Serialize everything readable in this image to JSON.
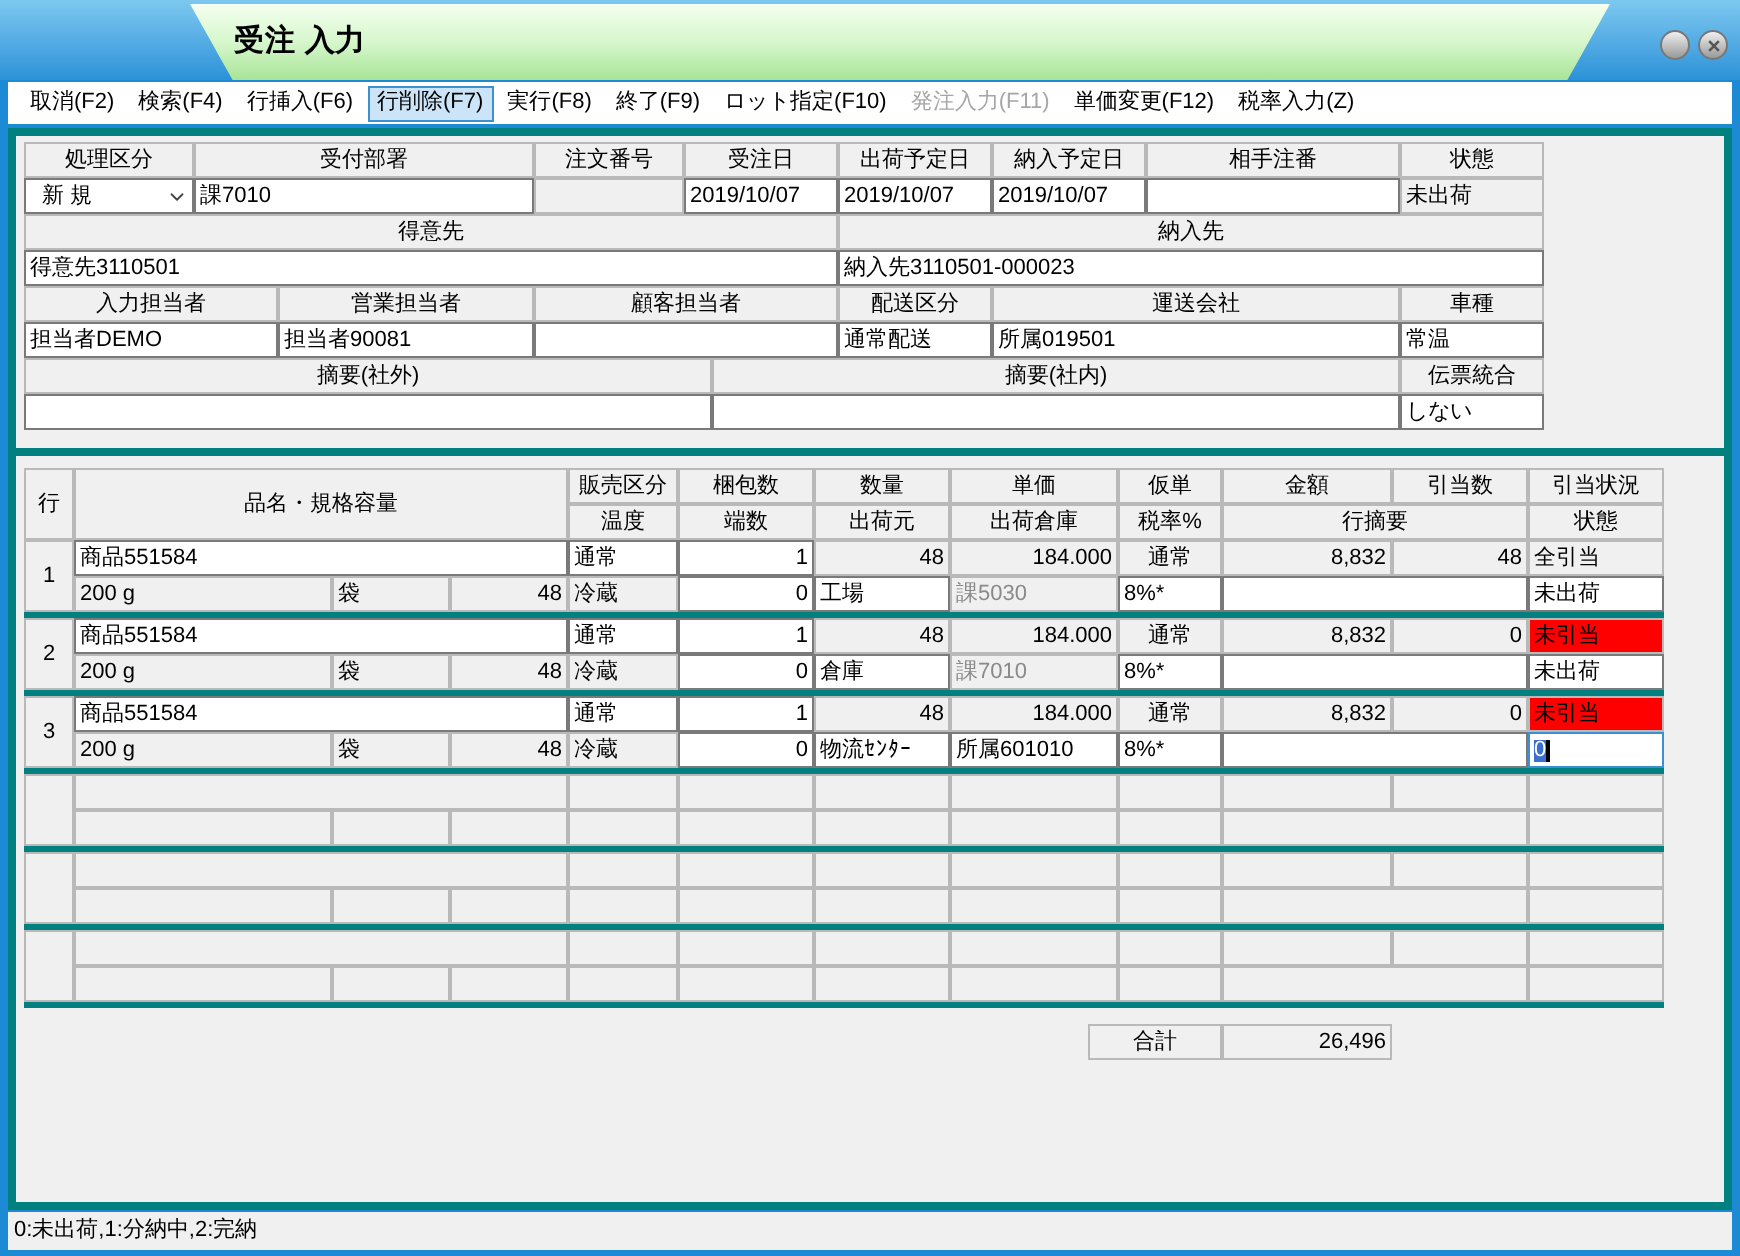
{
  "window": {
    "title": "受注 入力"
  },
  "toolbar": [
    {
      "label": "取消(F2)",
      "selected": false,
      "disabled": false
    },
    {
      "label": "検索(F4)",
      "selected": false,
      "disabled": false
    },
    {
      "label": "行挿入(F6)",
      "selected": false,
      "disabled": false
    },
    {
      "label": "行削除(F7)",
      "selected": true,
      "disabled": false
    },
    {
      "label": "実行(F8)",
      "selected": false,
      "disabled": false
    },
    {
      "label": "終了(F9)",
      "selected": false,
      "disabled": false
    },
    {
      "label": "ロット指定(F10)",
      "selected": false,
      "disabled": false
    },
    {
      "label": "発注入力(F11)",
      "selected": false,
      "disabled": true
    },
    {
      "label": "単価変更(F12)",
      "selected": false,
      "disabled": false
    },
    {
      "label": "税率入力(Z)",
      "selected": false,
      "disabled": false
    }
  ],
  "header": {
    "order": [
      {
        "label": "処理区分",
        "kind": "select",
        "value": "新 規"
      },
      {
        "label": "受付部署",
        "kind": "input",
        "value": "課7010"
      },
      {
        "label": "注文番号",
        "kind": "readonly"
      },
      {
        "label": "受注日",
        "kind": "input",
        "value": "2019/10/07"
      },
      {
        "label": "出荷予定日",
        "kind": "input",
        "value": "2019/10/07"
      },
      {
        "label": "納入予定日",
        "kind": "input",
        "value": "2019/10/07"
      },
      {
        "label": "相手注番",
        "kind": "input"
      },
      {
        "label": "状態",
        "kind": "readonly",
        "value": "未出荷"
      }
    ],
    "parties": [
      {
        "label": "得意先",
        "kind": "input",
        "value": "得意先3110501"
      },
      {
        "label": "納入先",
        "kind": "input",
        "value": "納入先3110501-000023"
      }
    ],
    "staff": [
      {
        "label": "入力担当者",
        "kind": "input",
        "value": "担当者DEMO"
      },
      {
        "label": "営業担当者",
        "kind": "input",
        "value": "担当者90081"
      },
      {
        "label": "顧客担当者",
        "kind": "input"
      },
      {
        "label": "配送区分",
        "kind": "input",
        "value": "通常配送"
      },
      {
        "label": "運送会社",
        "kind": "input",
        "value": "所属019501"
      },
      {
        "label": "車種",
        "kind": "input",
        "value": "常温"
      }
    ],
    "notes": [
      {
        "label": "摘要(社外)",
        "kind": "input"
      },
      {
        "label": "摘要(社内)",
        "kind": "input"
      },
      {
        "label": "伝票統合",
        "kind": "input",
        "value": "しない"
      }
    ]
  },
  "detail": {
    "header_top": [
      "行",
      "品名・規格容量",
      "販売区分",
      "梱包数",
      "数量",
      "単価",
      "仮単",
      "金額",
      "引当数",
      "引当状況"
    ],
    "header_bottom": [
      "温度",
      "端数",
      "出荷元",
      "出荷倉庫",
      "税率%",
      "行摘要",
      "状態"
    ],
    "rows": [
      {
        "line": "1",
        "product": "商品551584",
        "spec": "200 g",
        "unit": "袋",
        "per_pack": "48",
        "sales_type": "通常",
        "temperature": "冷蔵",
        "packages": "1",
        "fraction": "0",
        "quantity": "48",
        "origin": "工場",
        "unit_price": "184.000",
        "warehouse": "課5030",
        "warehouse_editable": false,
        "tentative": "通常",
        "tax": "8%*",
        "amount": "8,832",
        "allocated": "48",
        "allocation_status": "全引当",
        "allocation_alert": false,
        "shipping_status": "未出荷",
        "focused": false
      },
      {
        "line": "2",
        "product": "商品551584",
        "spec": "200 g",
        "unit": "袋",
        "per_pack": "48",
        "sales_type": "通常",
        "temperature": "冷蔵",
        "packages": "1",
        "fraction": "0",
        "quantity": "48",
        "origin": "倉庫",
        "unit_price": "184.000",
        "warehouse": "課7010",
        "warehouse_editable": false,
        "tentative": "通常",
        "tax": "8%*",
        "amount": "8,832",
        "allocated": "0",
        "allocation_status": "未引当",
        "allocation_alert": true,
        "shipping_status": "未出荷",
        "focused": false
      },
      {
        "line": "3",
        "product": "商品551584",
        "spec": "200 g",
        "unit": "袋",
        "per_pack": "48",
        "sales_type": "通常",
        "temperature": "冷蔵",
        "packages": "1",
        "fraction": "0",
        "quantity": "48",
        "origin": "物流ｾﾝﾀｰ",
        "unit_price": "184.000",
        "warehouse": "所属601010",
        "warehouse_editable": true,
        "tentative": "通常",
        "tax": "8%*",
        "amount": "8,832",
        "allocated": "0",
        "allocation_status": "未引当",
        "allocation_alert": true,
        "shipping_status": "0",
        "focused": true
      }
    ],
    "total": {
      "label": "合計",
      "value": "26,496"
    }
  },
  "status_bar": "0:未出荷,1:分納中,2:完納"
}
